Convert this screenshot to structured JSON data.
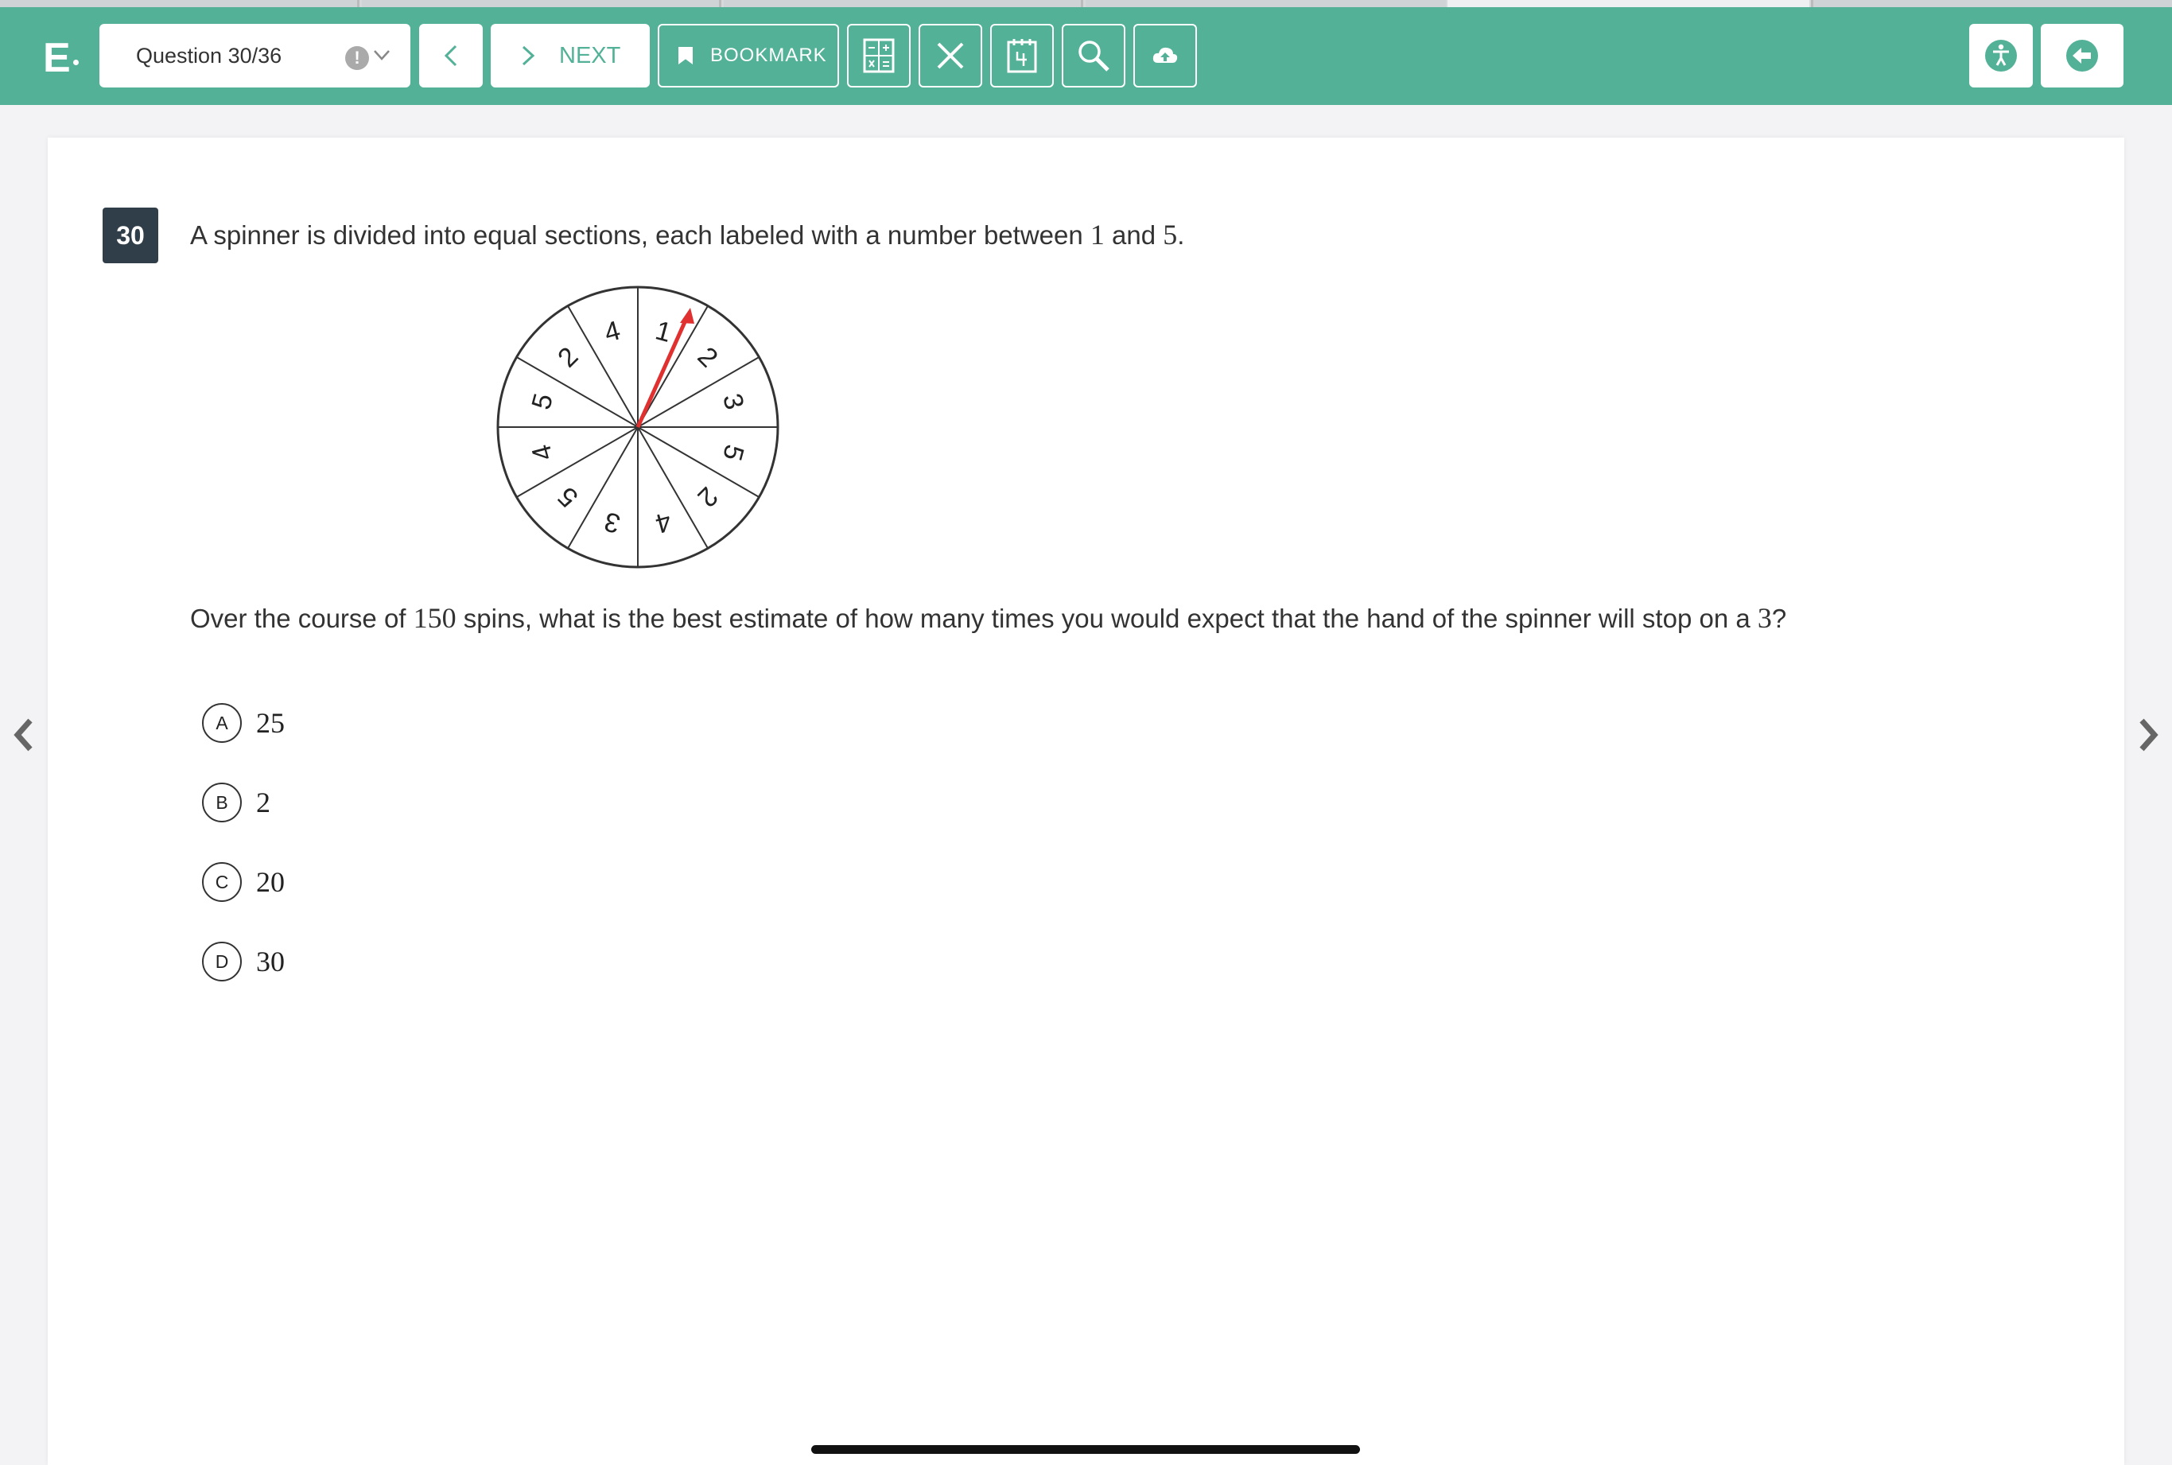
{
  "colors": {
    "toolbar": "#53b197",
    "accent": "#53b197",
    "number_badge": "#2f3e48",
    "spinner_hand": "#e03030"
  },
  "toolbar": {
    "logo_text": "E",
    "question_selector": "Question 30/36",
    "flag_icon_glyph": "!",
    "prev_icon": "chevron-left-icon",
    "next_label": "NEXT",
    "bookmark_label": "BOOKMARK",
    "tools": [
      "calculator-icon",
      "close-icon",
      "notepad-icon",
      "magnifier-icon",
      "cloud-upload-icon"
    ],
    "right_tools": [
      "accessibility-icon",
      "exit-arrow-icon"
    ]
  },
  "question": {
    "number": "30",
    "stem_prefix": "A spinner is divided into equal sections, each labeled with a number between ",
    "stem_num1": "1",
    "stem_and": " and ",
    "stem_num2": "5",
    "stem_end": ".",
    "question_prefix": "Over the course of ",
    "question_num": "150",
    "question_mid": " spins, what is the best estimate of how many times you would expect that the hand of the spinner will stop on a ",
    "question_target": "3",
    "question_end": "?"
  },
  "spinner": {
    "section_labels": [
      "1",
      "2",
      "3",
      "5",
      "2",
      "4",
      "3",
      "5",
      "4",
      "5",
      "2",
      "4"
    ],
    "hand_color": "#e03030"
  },
  "choices": [
    {
      "letter": "A",
      "value": "25"
    },
    {
      "letter": "B",
      "value": "2"
    },
    {
      "letter": "C",
      "value": "20"
    },
    {
      "letter": "D",
      "value": "30"
    }
  ],
  "navigation": {
    "left_arrow": "chevron-left-icon",
    "right_arrow": "chevron-right-icon"
  }
}
